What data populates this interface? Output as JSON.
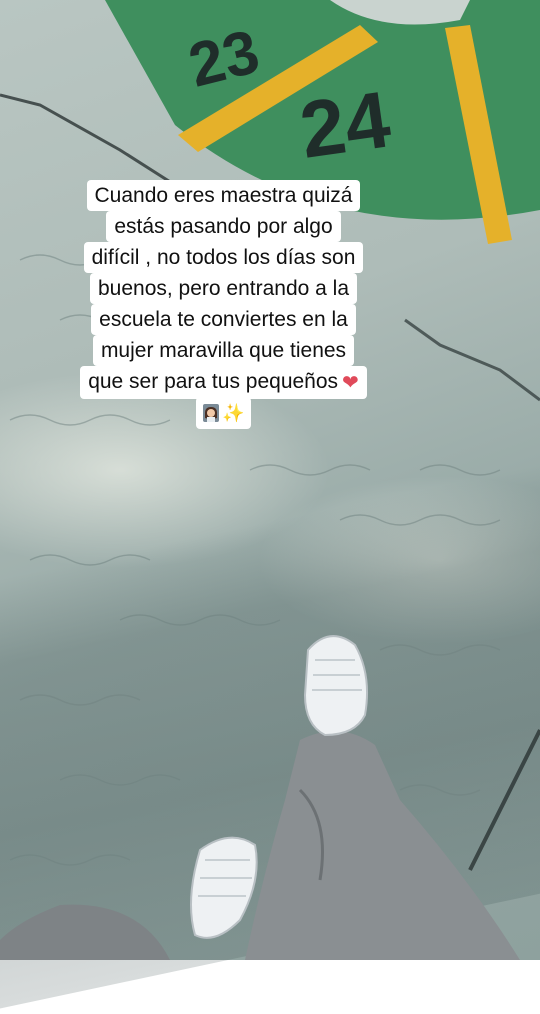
{
  "caption": {
    "lines": [
      "Cuando eres maestra quizá",
      "estás pasando por algo",
      "difícil , no todos los días son",
      "buenos,  pero entrando a la",
      "escuela te conviertes en la",
      "mujer maravilla que tienes",
      "que ser para tus pequeños"
    ],
    "heart_glyph": "❤",
    "sparkle_glyph": "✨"
  },
  "ground_markings": {
    "numbers": [
      "23",
      "24"
    ],
    "colors": {
      "ring_green": "#3f8f5e",
      "stripe_yellow": "#e5b12a",
      "number_ink": "#1f2d2a"
    }
  },
  "icons": [
    "heart-icon",
    "teacher-icon",
    "sparkles-icon"
  ]
}
